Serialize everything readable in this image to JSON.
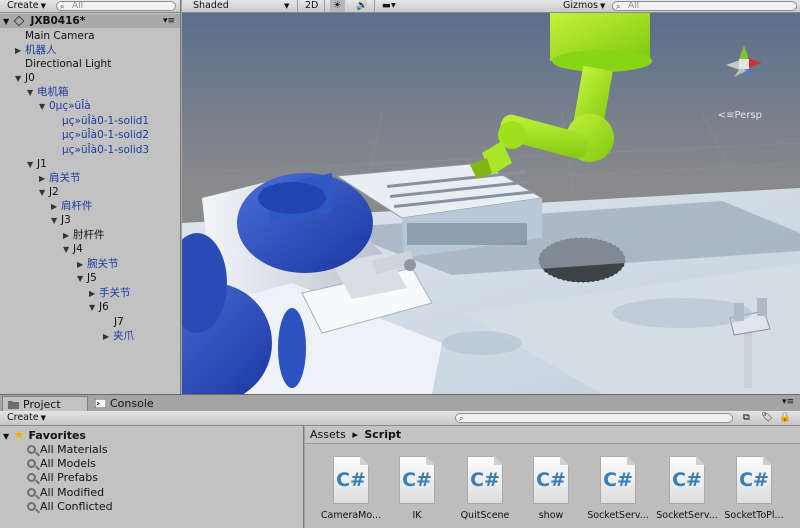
{
  "hierarchy": {
    "create_label": "Create",
    "search_placeholder": "All",
    "scene_name": "JXB0416*",
    "items": [
      {
        "label": "Main Camera"
      },
      {
        "label": "机器人"
      },
      {
        "label": "Directional Light"
      },
      {
        "label": "J0"
      },
      {
        "label": "电机箱"
      },
      {
        "label": "0μç»üÎà"
      },
      {
        "label": "μç»üÎà0-1-solid1"
      },
      {
        "label": "μç»üÎà0-1-solid2"
      },
      {
        "label": "μç»üÎà0-1-solid3"
      },
      {
        "label": "J1"
      },
      {
        "label": "肩关节"
      },
      {
        "label": "J2"
      },
      {
        "label": "肩杆件"
      },
      {
        "label": "J3"
      },
      {
        "label": "肘杆件"
      },
      {
        "label": "J4"
      },
      {
        "label": "腕关节"
      },
      {
        "label": "J5"
      },
      {
        "label": "手关节"
      },
      {
        "label": "J6"
      },
      {
        "label": "J7"
      },
      {
        "label": "夹爪"
      }
    ]
  },
  "scene_toolbar": {
    "shading_mode": "Shaded",
    "mode_2d": "2D",
    "gizmos_label": "Gizmos",
    "search_placeholder": "All",
    "projection_label": "Persp"
  },
  "tabs": [
    {
      "label": "Project"
    },
    {
      "label": "Console"
    }
  ],
  "project": {
    "create_label": "Create",
    "favorites_label": "Favorites",
    "favorites": [
      "All Materials",
      "All Models",
      "All Prefabs",
      "All Modified",
      "All Conflicted"
    ],
    "breadcrumb_root": "Assets",
    "breadcrumb_current": "Script",
    "assets": [
      {
        "name": "CameraMo...",
        "glyph": "C#"
      },
      {
        "name": "IK",
        "glyph": "C#"
      },
      {
        "name": "QuitScene",
        "glyph": "C#"
      },
      {
        "name": "show",
        "glyph": "C#"
      },
      {
        "name": "SocketServ...",
        "glyph": "C#"
      },
      {
        "name": "SocketServ...",
        "glyph": "C#"
      },
      {
        "name": "SocketToPl...",
        "glyph": "C#"
      }
    ]
  },
  "colors": {
    "panel": "#c2c2c2",
    "tree_blue": "#1d3b9e",
    "robot_green": "#9ee01a",
    "motor_blue": "#2a4fb8",
    "csharp": "#3a7eb8"
  }
}
